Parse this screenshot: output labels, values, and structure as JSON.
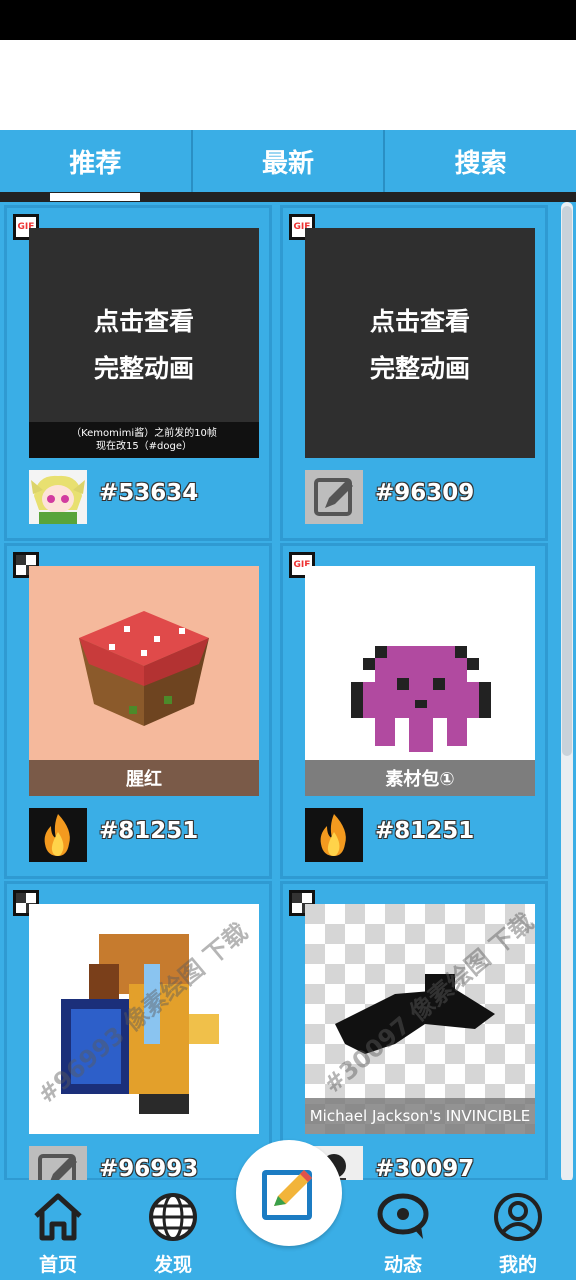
{
  "tabs": [
    {
      "label": "推荐"
    },
    {
      "label": "最新"
    },
    {
      "label": "搜索"
    }
  ],
  "cards": [
    {
      "badge": "GIF",
      "thumb_line1": "点击查看",
      "thumb_line2": "完整动画",
      "caption_line1": "（Kemomimi酱）之前发的10帧",
      "caption_line2": "现在改15（#doge）",
      "id": "#53634",
      "avatar_icon": "anime-girl-avatar"
    },
    {
      "badge": "GIF",
      "thumb_line1": "点击查看",
      "thumb_line2": "完整动画",
      "id": "#96309",
      "avatar_icon": "pencil-avatar"
    },
    {
      "badge": "",
      "title": "腥红",
      "id": "#81251",
      "avatar_icon": "fire-avatar"
    },
    {
      "badge": "GIF",
      "title": "素材包①",
      "id": "#81251",
      "avatar_icon": "fire-avatar"
    },
    {
      "badge": "",
      "watermark": "#96993 像素绘图 下载",
      "id": "#96993",
      "avatar_icon": "pencil-avatar"
    },
    {
      "badge": "",
      "watermark": "#30097 像素绘图 下载",
      "title": "Michael Jackson's INVINCIBLE",
      "id": "#30097",
      "avatar_icon": "character-avatar"
    }
  ],
  "bottom_nav": [
    {
      "label": "首页",
      "icon": "home-icon"
    },
    {
      "label": "发现",
      "icon": "globe-icon"
    },
    {
      "label": "动态",
      "icon": "chat-icon"
    },
    {
      "label": "我的",
      "icon": "user-icon"
    }
  ],
  "fab": {
    "icon": "edit-icon"
  },
  "colors": {
    "primary": "#3aaee6",
    "dark": "#2f2f2f",
    "label_bar": "#7a5a48"
  }
}
